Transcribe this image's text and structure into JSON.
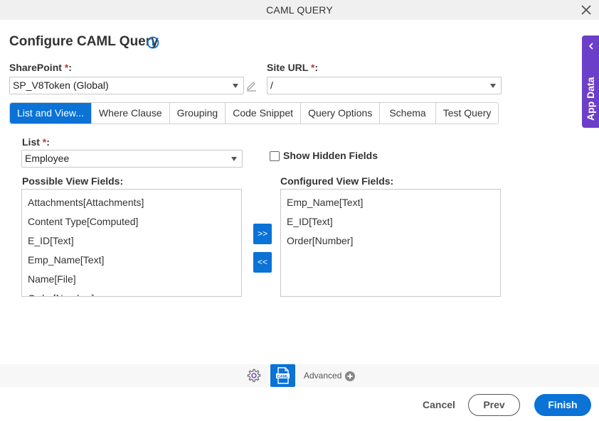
{
  "window": {
    "title": "CAML QUERY",
    "close_icon": "close-icon"
  },
  "header": {
    "title": "Configure CAML Query",
    "info_icon": "info-icon"
  },
  "sharepoint": {
    "label": "SharePoint",
    "required_mark": "*",
    "suffix": ":",
    "value": "SP_V8Token (Global)"
  },
  "site_url": {
    "label": "Site URL",
    "required_mark": "*",
    "suffix": ":",
    "value": "/"
  },
  "tabs": [
    {
      "label": "List and View...",
      "active": true
    },
    {
      "label": "Where Clause",
      "active": false
    },
    {
      "label": "Grouping",
      "active": false
    },
    {
      "label": "Code Snippet",
      "active": false
    },
    {
      "label": "Query Options",
      "active": false
    },
    {
      "label": "Schema",
      "active": false
    },
    {
      "label": "Test Query",
      "active": false
    }
  ],
  "list": {
    "label": "List",
    "required_mark": "*",
    "suffix": ":",
    "value": "Employee"
  },
  "show_hidden_fields": {
    "label": "Show Hidden Fields",
    "checked": false
  },
  "possible_view_fields": {
    "label": "Possible View Fields:",
    "items": [
      "Attachments[Attachments]",
      "Content Type[Computed]",
      "E_ID[Text]",
      "Emp_Name[Text]",
      "Name[File]",
      "Order[Number]"
    ]
  },
  "configured_view_fields": {
    "label": "Configured View Fields:",
    "items": [
      "Emp_Name[Text]",
      "E_ID[Text]",
      "Order[Number]"
    ]
  },
  "move_buttons": {
    "add": ">>",
    "remove": "<<"
  },
  "bottom_bar": {
    "advanced_label": "Advanced",
    "caml_icon_text": "CAML"
  },
  "footer": {
    "cancel": "Cancel",
    "prev": "Prev",
    "finish": "Finish"
  },
  "side_panel": {
    "label": "App Data"
  },
  "colors": {
    "primary": "#0b72d6",
    "side_panel": "#6c3fc9",
    "required": "#c0392b"
  }
}
